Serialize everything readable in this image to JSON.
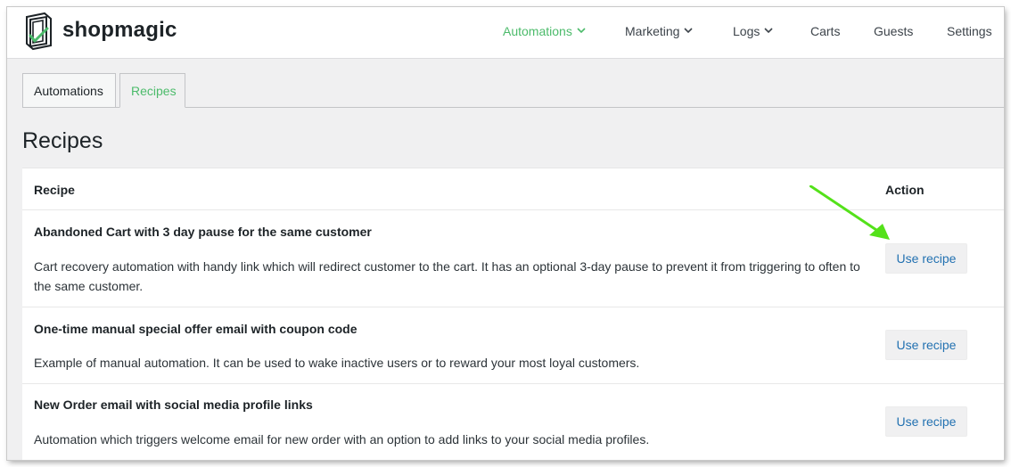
{
  "brand": {
    "name": "shopmagic"
  },
  "nav": {
    "items": [
      {
        "label": "Automations",
        "dropdown": true,
        "active": true
      },
      {
        "label": "Marketing",
        "dropdown": true,
        "active": false
      },
      {
        "label": "Logs",
        "dropdown": true,
        "active": false
      },
      {
        "label": "Carts",
        "dropdown": false,
        "active": false
      },
      {
        "label": "Guests",
        "dropdown": false,
        "active": false
      },
      {
        "label": "Settings",
        "dropdown": false,
        "active": false
      }
    ]
  },
  "tabs": [
    {
      "label": "Automations",
      "active": false
    },
    {
      "label": "Recipes",
      "active": true
    }
  ],
  "page": {
    "title": "Recipes"
  },
  "table": {
    "headers": {
      "recipe": "Recipe",
      "action": "Action"
    },
    "rows": [
      {
        "title": "Abandoned Cart with 3 day pause for the same customer",
        "description": "Cart recovery automation with handy link which will redirect customer to the cart. It has an optional 3-day pause to prevent it from triggering to often to the same customer.",
        "action": "Use recipe"
      },
      {
        "title": "One-time manual special offer email with coupon code",
        "description": "Example of manual automation. It can be used to wake inactive users or to reward your most loyal customers.",
        "action": "Use recipe"
      },
      {
        "title": "New Order email with social media profile links",
        "description": "Automation which triggers welcome email for new order with an option to add links to your social media profiles.",
        "action": "Use recipe"
      }
    ]
  },
  "colors": {
    "accent": "#4cbb6b",
    "link": "#2271b1",
    "annotation_arrow": "#54e11a",
    "page_background": "#f0f0f1"
  },
  "icons": {
    "logo": "shopmagic-logo-icon",
    "dropdown": "chevron-down-icon",
    "annotation": "green-arrow-icon"
  }
}
